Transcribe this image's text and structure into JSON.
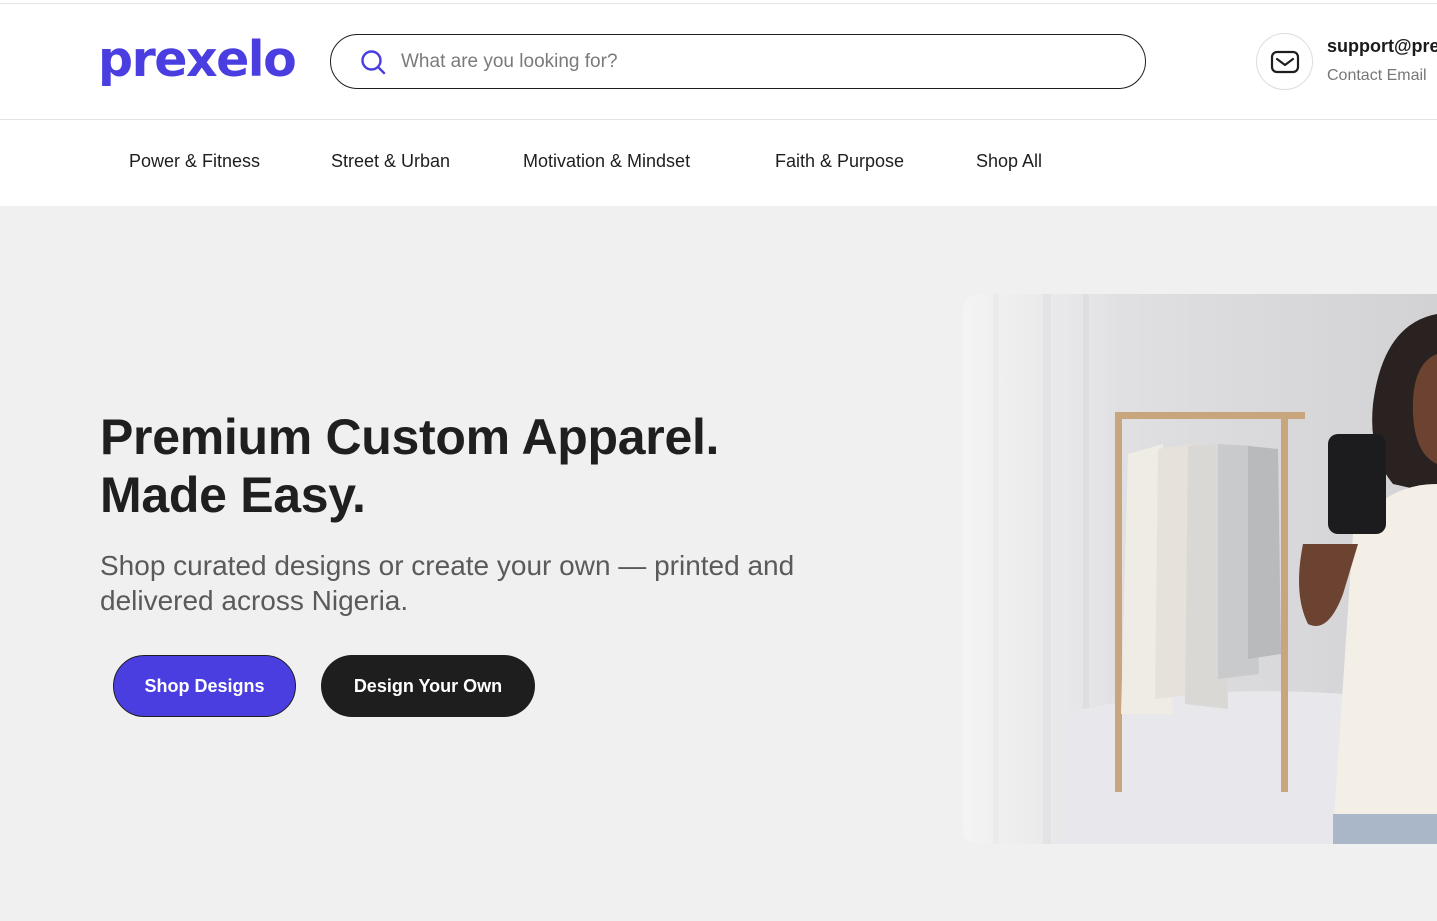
{
  "brand": {
    "logo_text": "prexelo",
    "accent": "#4a3ee0",
    "dark": "#1e1e1e"
  },
  "search": {
    "placeholder": "What are you looking for?",
    "value": "",
    "icon": "search-icon"
  },
  "contact": {
    "email": "support@pre",
    "label": "Contact Email",
    "icon": "mail-icon"
  },
  "nav": {
    "items": [
      {
        "label": "Power & Fitness"
      },
      {
        "label": "Street & Urban"
      },
      {
        "label": "Motivation & Mindset"
      },
      {
        "label": "Faith & Purpose"
      },
      {
        "label": "Shop All"
      }
    ]
  },
  "hero": {
    "title_line1": "Premium Custom Apparel.",
    "title_line2": "Made Easy.",
    "subtitle": "Shop curated designs or create your own — printed and delivered across Nigeria.",
    "primary_button": "Shop Designs",
    "secondary_button": "Design Your Own",
    "image_subject": "woman-taking-selfie-in-custom-tshirt"
  }
}
